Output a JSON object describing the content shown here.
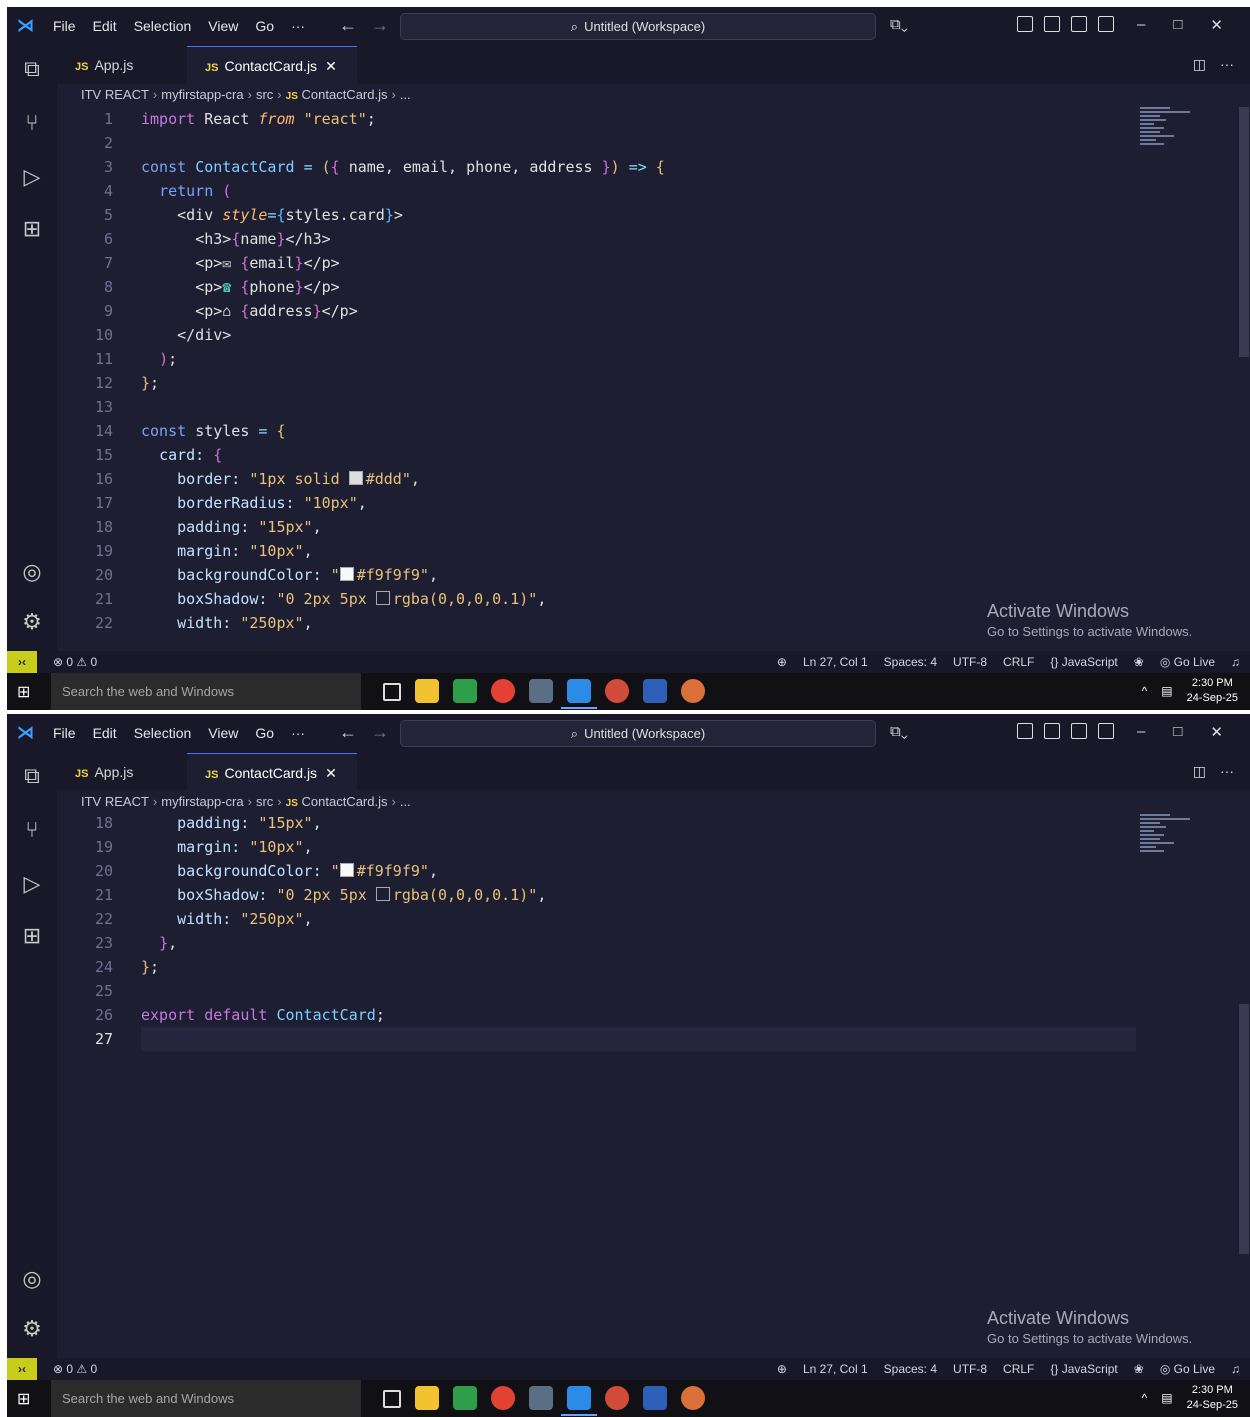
{
  "menu": [
    "File",
    "Edit",
    "Selection",
    "View",
    "Go",
    "···"
  ],
  "window_title": "Untitled (Workspace)",
  "tabs": [
    {
      "icon": "JS",
      "label": "App.js",
      "active": false
    },
    {
      "icon": "JS",
      "label": "ContactCard.js",
      "active": true,
      "close": "✕"
    }
  ],
  "breadcrumb": [
    "ITV REACT",
    "myfirstapp-cra",
    "src",
    "ContactCard.js",
    "..."
  ],
  "activate_windows": {
    "title": "Activate Windows",
    "subtitle": "Go to Settings to activate Windows."
  },
  "status": {
    "problems": "⊗ 0 ⚠ 0",
    "zoom_icon": "zoom-in-icon",
    "position": "Ln 27, Col 1",
    "spaces": "Spaces: 4",
    "encoding": "UTF-8",
    "eol": "CRLF",
    "language": "{} JavaScript",
    "golive": "Go Live"
  },
  "taskbar": {
    "search_placeholder": "Search the web and Windows",
    "time": "2:30 PM",
    "date": "24-Sep-25"
  },
  "colors": {
    "editor_bg": "#1e1e32",
    "sidebar_bg": "#181829",
    "accent": "#4c6fff",
    "remote_bg": "#c8cc1a"
  },
  "screens": [
    {
      "first_line": 1,
      "last_line": 22,
      "current_line": 27
    },
    {
      "first_line": 18,
      "last_line": 27,
      "current_line": 27
    }
  ],
  "code_lines": {
    "1": "import React from \"react\";",
    "2": "",
    "3": "const ContactCard = ({ name, email, phone, address }) => {",
    "4": "  return (",
    "5": "    <div style={styles.card}>",
    "6": "      <h3>{name}</h3>",
    "7": "      <p>✉ {email}</p>",
    "8": "      <p>📞 {phone}</p>",
    "9": "      <p>🏠 {address}</p>",
    "10": "    </div>",
    "11": "  );",
    "12": "};",
    "13": "",
    "14": "const styles = {",
    "15": "  card: {",
    "16": "    border: \"1px solid #ddd\",",
    "17": "    borderRadius: \"10px\",",
    "18": "    padding: \"15px\",",
    "19": "    margin: \"10px\",",
    "20": "    backgroundColor: \"#f9f9f9\",",
    "21": "    boxShadow: \"0 2px 5px rgba(0,0,0,0.1)\",",
    "22": "    width: \"250px\",",
    "23": "  },",
    "24": "};",
    "25": "",
    "26": "export default ContactCard;",
    "27": ""
  }
}
